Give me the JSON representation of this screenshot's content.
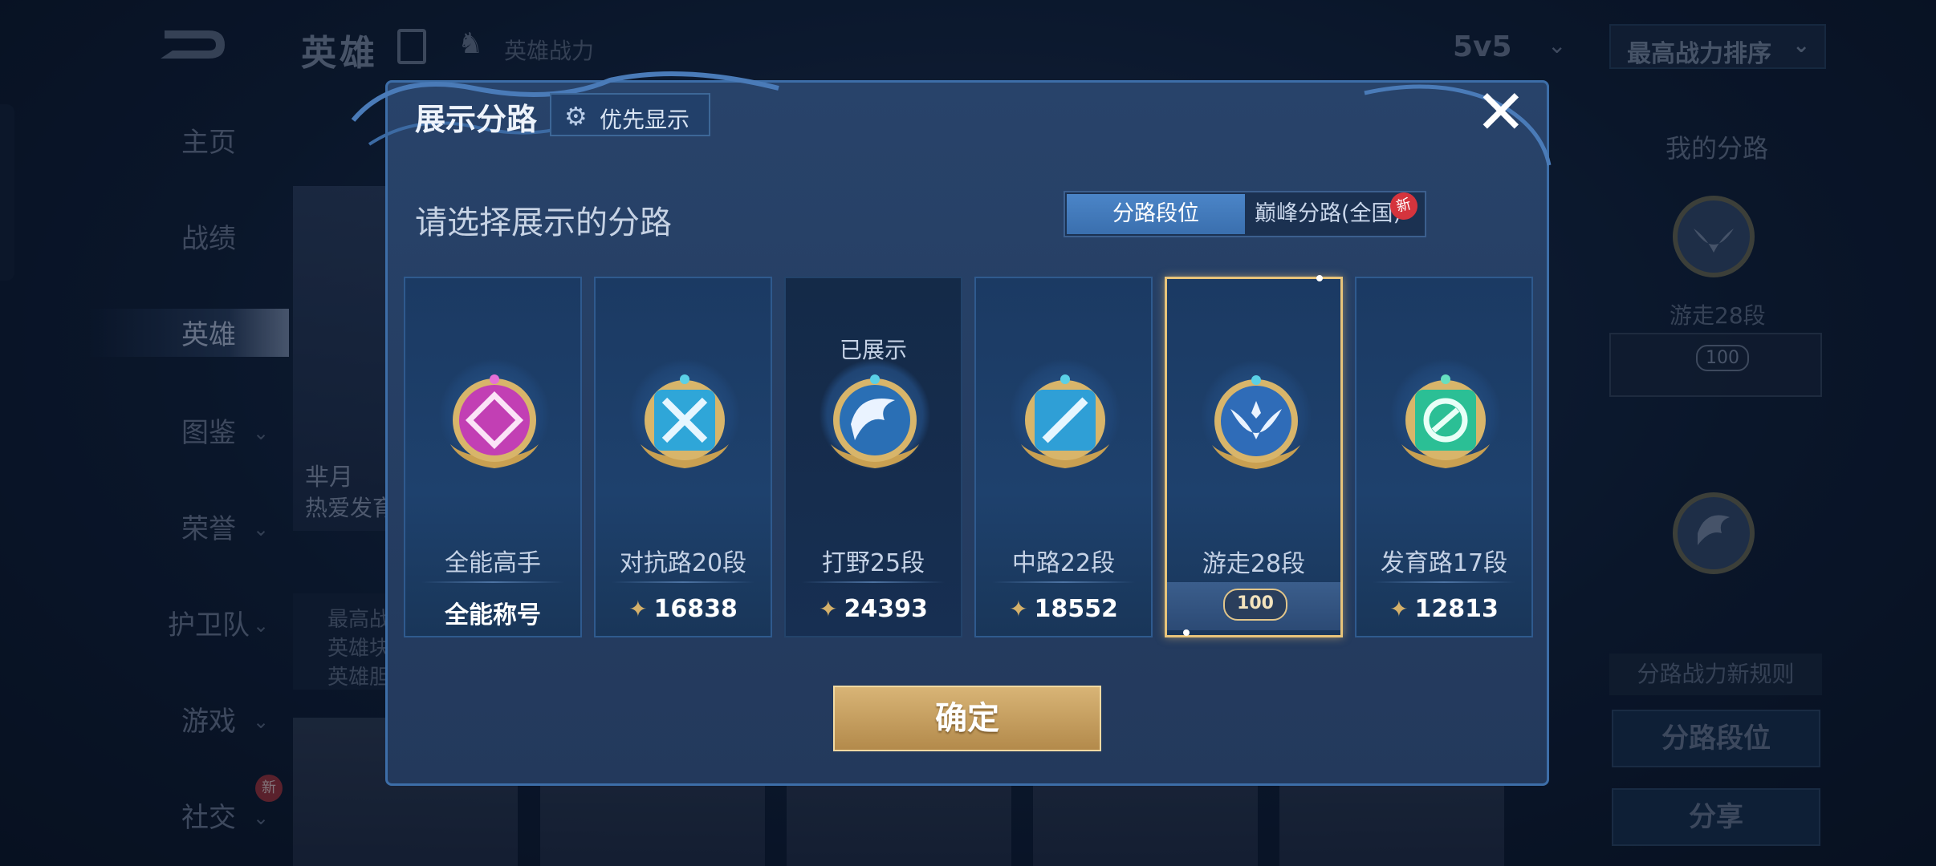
{
  "background": {
    "title": "英雄",
    "hero_power_label": "英雄战力",
    "mode": "5v5",
    "sort": "最高战力排序",
    "nav": [
      {
        "label": "主页"
      },
      {
        "label": "战绩"
      },
      {
        "label": "英雄"
      },
      {
        "label": "图鉴"
      },
      {
        "label": "荣誉"
      },
      {
        "label": "护卫队"
      },
      {
        "label": "游戏"
      },
      {
        "label": "社交"
      }
    ],
    "nav_new_badge": "新",
    "hero_card": {
      "name": "芈月",
      "subtitle": "热爱发育"
    },
    "hero_stats": [
      "最高战",
      "英雄块",
      "英雄胆"
    ],
    "right_panel": {
      "title": "我的分路",
      "lane_label": "游走28段",
      "lane_stars": "100",
      "rule_text": "分路战力新规则",
      "btn_lane_rank": "分路段位",
      "btn_share": "分享"
    }
  },
  "modal": {
    "title": "展示分路",
    "priority_button": "优先显示",
    "subtitle": "请选择展示的分路",
    "tabs": [
      {
        "label": "分路段位",
        "active": true
      },
      {
        "label": "巅峰分路(全国)",
        "active": false,
        "badge": "新"
      }
    ],
    "lanes": [
      {
        "name": "全能高手",
        "value": "全能称号",
        "color": "#c23fb4",
        "state": "normal"
      },
      {
        "name": "对抗路20段",
        "value": "16838",
        "color": "#2fa6d8",
        "state": "normal"
      },
      {
        "name": "打野25段",
        "value": "24393",
        "color": "#2a6fb5",
        "state": "shown",
        "shown_label": "已展示"
      },
      {
        "name": "中路22段",
        "value": "18552",
        "color": "#2f9fd6",
        "state": "normal"
      },
      {
        "name": "游走28段",
        "value": "100",
        "color": "#2f6cb8",
        "state": "selected"
      },
      {
        "name": "发育路17段",
        "value": "12813",
        "color": "#2bbf95",
        "state": "normal"
      }
    ],
    "confirm_button": "确定"
  }
}
